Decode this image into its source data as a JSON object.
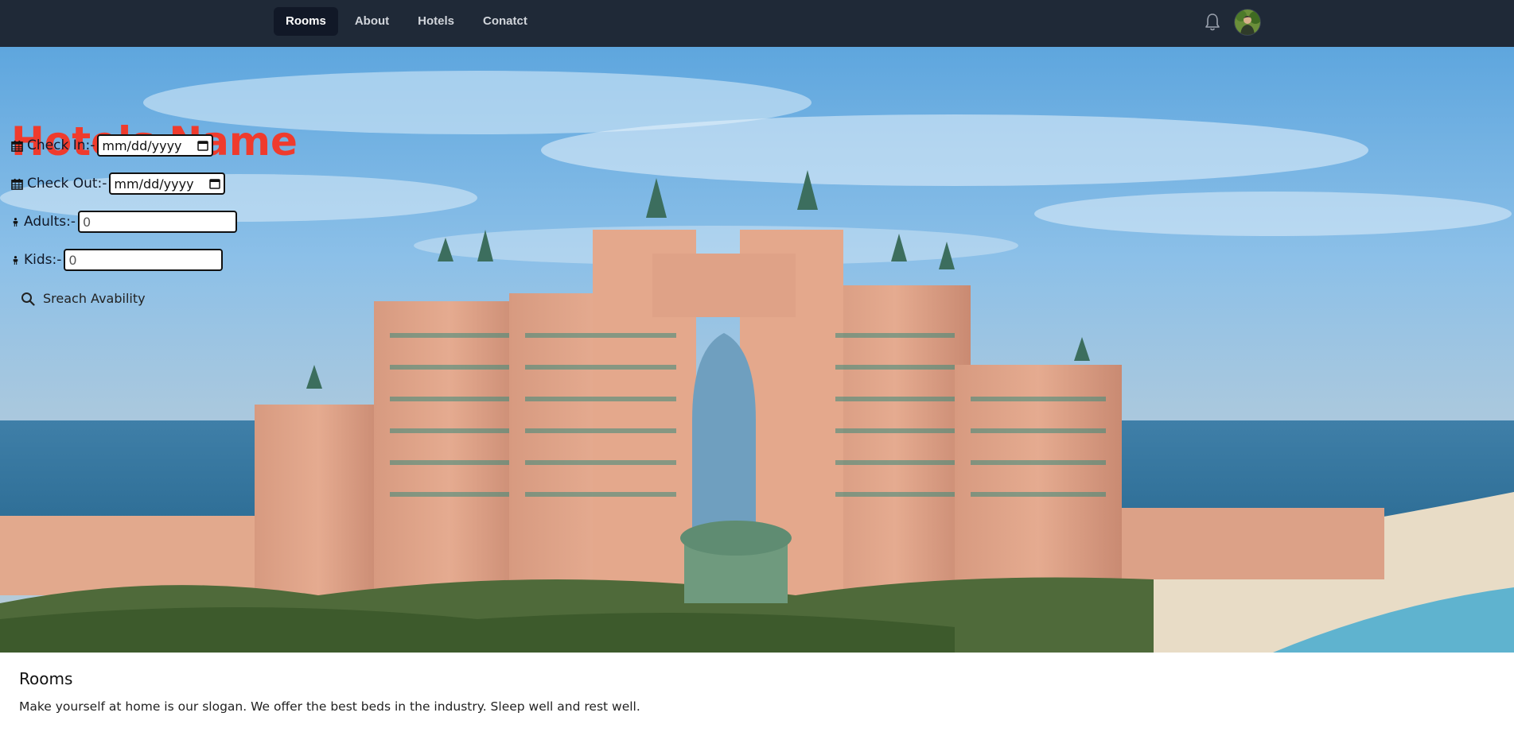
{
  "nav": {
    "links": [
      {
        "label": "Rooms",
        "active": true
      },
      {
        "label": "About"
      },
      {
        "label": "Hotels"
      },
      {
        "label": "Conatct"
      }
    ],
    "bell_icon": "bell-icon",
    "avatar_icon": "user-avatar"
  },
  "hero": {
    "title": "Hotels Name",
    "title_color": "#ef3b2d",
    "check_in": {
      "label": "Check In:-",
      "placeholder": "mm/dd/yyyy",
      "icon": "calendar-icon"
    },
    "check_out": {
      "label": "Check Out:-",
      "placeholder": "mm/dd/yyyy",
      "icon": "calendar-icon"
    },
    "adults": {
      "label": "Adults:-",
      "value": "0",
      "icon": "person-icon"
    },
    "kids": {
      "label": "Kids:-",
      "value": "0",
      "icon": "person-icon"
    },
    "search_button": {
      "label": "Sreach Avability",
      "icon": "search-icon"
    }
  },
  "section": {
    "title": "Rooms",
    "text": "Make yourself at home is our slogan. We offer the best beds in the industry. Sleep well and rest well."
  },
  "colors": {
    "navbar": "#1f2937",
    "active_link": "#111827",
    "accent": "#ef3b2d"
  }
}
